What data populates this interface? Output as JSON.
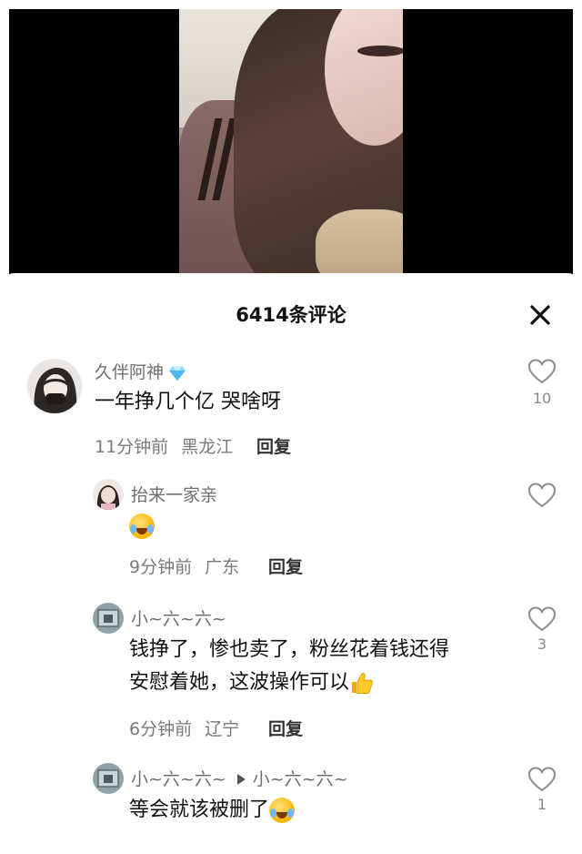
{
  "sheet": {
    "title": "6414条评论"
  },
  "comments": [
    {
      "author": "久伴阿神",
      "text": "一年挣几个亿 哭啥呀",
      "time": "11分钟前",
      "location": "黑龙江",
      "reply_label": "回复",
      "likes": "10"
    },
    {
      "author": "抬来一家亲",
      "text": "",
      "time": "9分钟前",
      "location": "广东",
      "reply_label": "回复",
      "likes": ""
    },
    {
      "author": "小~六~六~",
      "text_line1": "钱挣了，惨也卖了，粉丝花着钱还得",
      "text_line2": "安慰着她，这波操作可以",
      "time": "6分钟前",
      "location": "辽宁",
      "reply_label": "回复",
      "likes": "3"
    },
    {
      "author": "小~六~六~",
      "reply_to": "小~六~六~",
      "text": "等会就该被删了",
      "likes": "1"
    }
  ],
  "icons": {
    "close": "close-icon",
    "like": "heart-outline-icon",
    "badge": "diamond-icon",
    "emoji_cry": "crying-laughing-emoji",
    "emoji_thumb": "thumbs-up-emoji"
  },
  "colors": {
    "author": "#6f6f6f",
    "meta": "#7a7a7a",
    "text": "#111111",
    "diamond": "#7fd3ff"
  }
}
